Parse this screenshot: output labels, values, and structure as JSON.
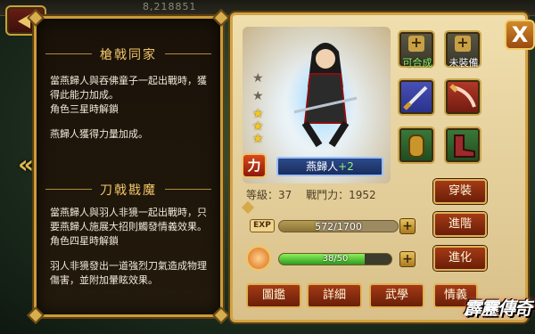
{
  "topbar": {
    "faint_text": "8,218851"
  },
  "left_panel": {
    "sections": [
      {
        "title": "槍戟同家",
        "paragraphs": [
          "當燕歸人與吞佛童子一起出戰時，獲得此能力加成。",
          "角色三星時解鎖",
          "燕歸人獲得力量加成。"
        ]
      },
      {
        "title": "刀戟戡魔",
        "paragraphs": [
          "當燕歸人與羽人非獍一起出戰時，只要燕歸人施展大招則觸發情義效果。",
          "角色四星時解鎖",
          "羽人非獍發出一道強烈刀氣造成物理傷害，並附加暈眩效果。"
        ]
      }
    ]
  },
  "hero": {
    "name": "燕歸人",
    "plus": "+2",
    "type_badge": "力",
    "stars_filled": 3,
    "stars_total": 5,
    "level_label": "等級：37",
    "power_label": "戰鬥力：1952"
  },
  "slots": [
    {
      "label": "可合成",
      "kind": "empty-plus",
      "color": "#8dff6a"
    },
    {
      "label": "未裝備",
      "kind": "empty-plus",
      "color": "#ffffff"
    },
    {
      "icon": "sword-icon",
      "kind": "blue"
    },
    {
      "icon": "blade-icon",
      "kind": "red"
    },
    {
      "icon": "armguard-icon",
      "kind": "green"
    },
    {
      "icon": "boot-icon",
      "kind": "green"
    }
  ],
  "exp": {
    "badge": "EXP",
    "text": "572/1700",
    "current": 572,
    "max": 1700
  },
  "soul": {
    "text": "38/50",
    "current": 38,
    "max": 50
  },
  "actions": {
    "equip": "穿裝",
    "advance": "進階",
    "evolve": "進化"
  },
  "tabs": [
    "圖鑑",
    "詳細",
    "武學",
    "情義"
  ],
  "close_label": "X",
  "logo_text": "霹靂傳奇",
  "colors": {
    "accent_gold": "#d0a344",
    "button_red": "#a33a16",
    "exp_green": "#8cf05a"
  }
}
